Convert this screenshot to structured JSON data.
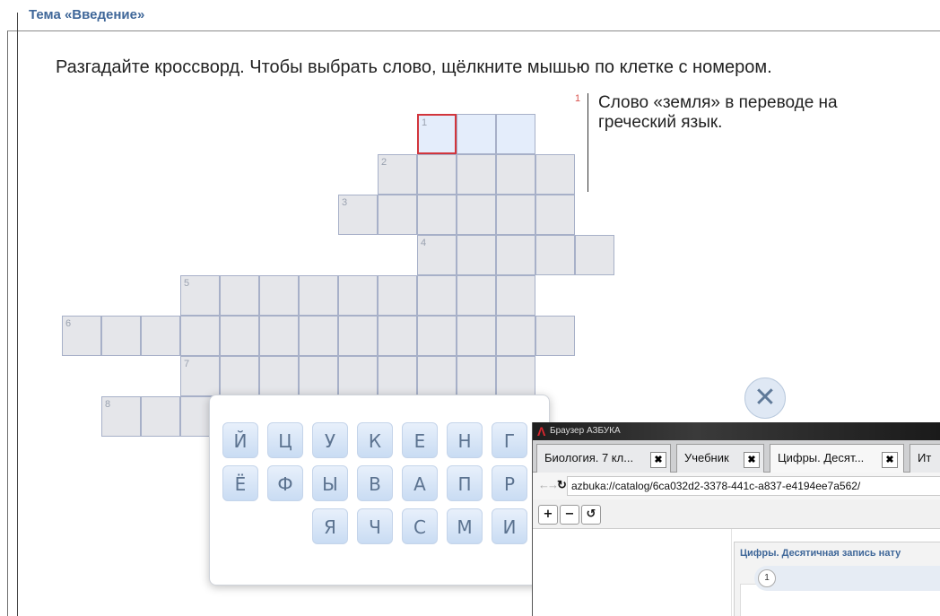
{
  "topic": "Тема «Введение»",
  "instruction": "Разгадайте кроссворд. Чтобы выбрать слово, щёлкните мышью по клетке с номером.",
  "clue": {
    "number": "1",
    "text": "Слово «земля» в переводе на греческий язык."
  },
  "crossword": {
    "numbers": [
      "1",
      "2",
      "3",
      "4",
      "5",
      "6",
      "7",
      "8"
    ]
  },
  "keyboard": {
    "row1": [
      "Й",
      "Ц",
      "У",
      "К",
      "Е",
      "Н",
      "Г"
    ],
    "row2": [
      "Ё",
      "Ф",
      "Ы",
      "В",
      "А",
      "П",
      "Р"
    ],
    "row3": [
      "Я",
      "Ч",
      "С",
      "М",
      "И"
    ],
    "close": "✕"
  },
  "browser": {
    "window_title": "Браузер АЗБУКА",
    "logo": "Λ",
    "tabs": [
      "Биология. 7 кл...",
      "Учебник",
      "Цифры. Десят...",
      "Ит"
    ],
    "tab_close": "✖",
    "nav": {
      "back": "←",
      "forward": "→",
      "reload": "↻"
    },
    "address": "azbuka://catalog/6ca032d2-3378-441c-a837-e4194ee7a562/",
    "zoom": {
      "in": "+",
      "out": "−",
      "reset": "↺"
    },
    "doc_title": "Цифры. Десятичная запись нату",
    "doc_item": "1"
  }
}
